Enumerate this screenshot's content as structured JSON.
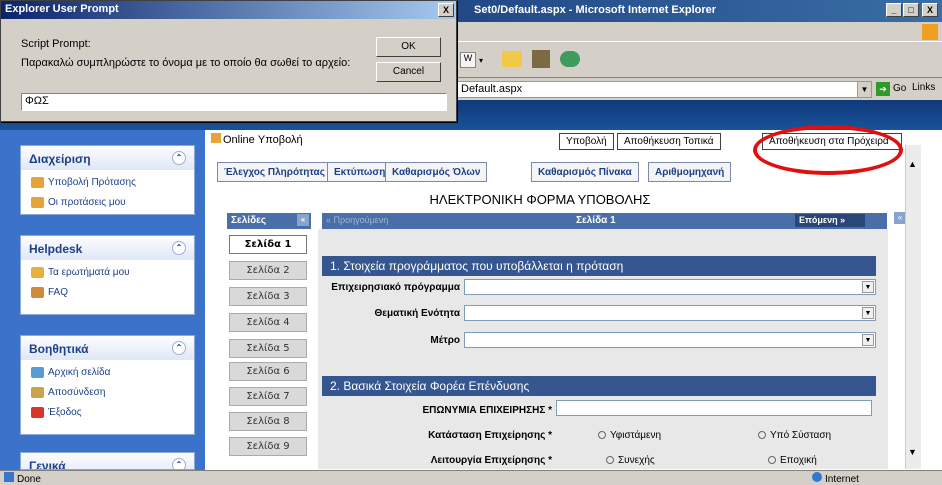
{
  "window": {
    "title": "Set0/Default.aspx - Microsoft Internet Explorer",
    "minimize": "_",
    "restore": "□",
    "close": "X"
  },
  "address": {
    "value": "Default.aspx",
    "go": "Go",
    "links": "Links"
  },
  "dialog": {
    "title": "Explorer User Prompt",
    "close": "X",
    "label": "Script Prompt:",
    "message": "Παρακαλώ συμπληρώστε το όνομα με το οποίο θα σωθεί το αρχείο:",
    "ok": "OK",
    "cancel": "Cancel",
    "input_value": "ΦΩΣ"
  },
  "sidebar": {
    "cards": [
      {
        "title": "Διαχείριση",
        "items": [
          "Υποβολή Πρότασης",
          "Οι προτάσεις μου"
        ]
      },
      {
        "title": "Helpdesk",
        "items": [
          "Τα ερωτήματά μου",
          "FAQ"
        ]
      },
      {
        "title": "Βοηθητικά",
        "items": [
          "Αρχική σελίδα",
          "Αποσύνδεση",
          "Έξοδος"
        ]
      },
      {
        "title": "Γενικά",
        "items": []
      }
    ]
  },
  "content": {
    "tab_title": "Online Υποβολή",
    "top_buttons": [
      "Υποβολή",
      "Αποθήκευση Τοπικά",
      "Αποθήκευση στα Πρόχειρα"
    ],
    "tools": [
      "Έλεγχος Πληρότητας",
      "Εκτύπωση",
      "Καθαρισμός Όλων",
      "Καθαρισμός Πίνακα",
      "Αριθμομηχανή"
    ],
    "form_title": "ΗΛΕΚΤΡΟΝΙΚΗ ΦΟΡΜΑ ΥΠΟΒΟΛΗΣ",
    "pages_label": "Σελίδες",
    "pages_collapse": "«",
    "pages": [
      "Σελίδα 1",
      "Σελίδα 2",
      "Σελίδα 3",
      "Σελίδα 4",
      "Σελίδα 5",
      "Σελίδα 6",
      "Σελίδα 7",
      "Σελίδα 8",
      "Σελίδα 9"
    ],
    "pager": {
      "prev": "« Προηγούμενη",
      "current": "Σελίδα 1",
      "next": "Επόμενη »"
    },
    "section1": "1. Στοιχεία προγράμματος που υποβάλλεται η πρόταση",
    "fields1": [
      "Επιχειρησιακό πρόγραμμα",
      "Θεματική Ενότητα",
      "Μέτρο"
    ],
    "section2": "2. Βασικά Στοιχεία Φορέα Επένδυσης",
    "company_name_label": "ΕΠΩΝΥΜΙΑ ΕΠΙΧΕΙΡΗΣΗΣ *",
    "status_label": "Κατάσταση Επιχείρησης *",
    "status_options": [
      "Υφιστάμενη",
      "Υπό Σύσταση"
    ],
    "operation_label": "Λειτουργία Επιχείρησης *",
    "operation_options": [
      "Συνεχής",
      "Εποχική"
    ]
  },
  "statusbar": {
    "left": "Done",
    "zone": "Internet"
  }
}
